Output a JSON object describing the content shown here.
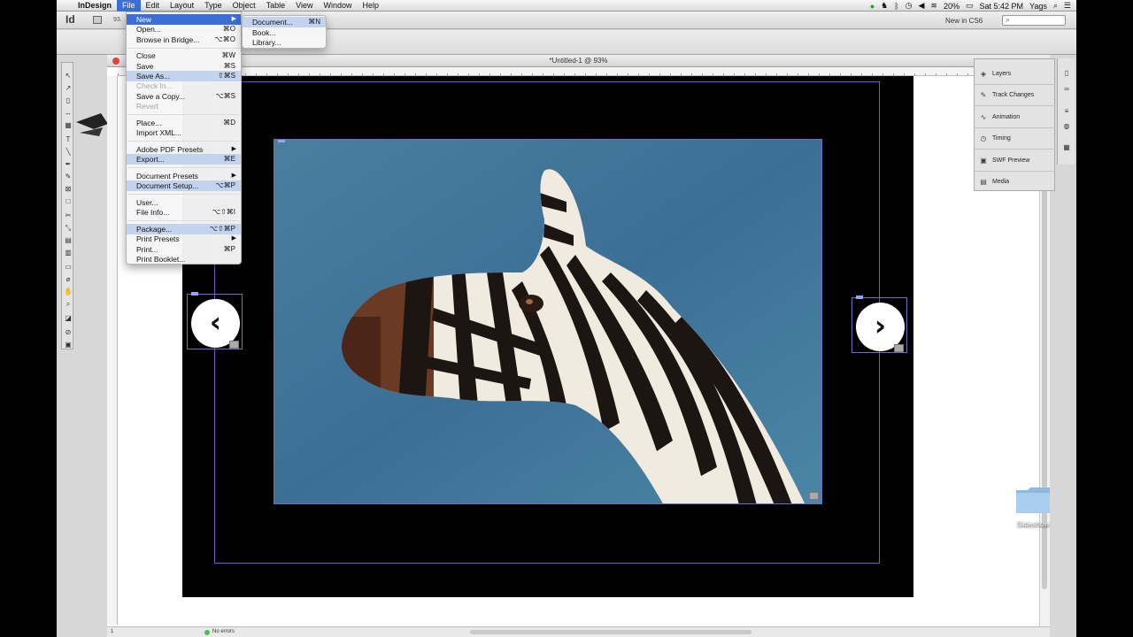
{
  "menubar": {
    "app_name": "InDesign",
    "items": [
      "File",
      "Edit",
      "Layout",
      "Type",
      "Object",
      "Table",
      "View",
      "Window",
      "Help"
    ],
    "battery": "20%",
    "clock": "Sat 5:42 PM",
    "user": "Yags"
  },
  "appbar": {
    "logo": "Id",
    "zoom_text": "93.",
    "workspace": "New in CS6"
  },
  "file_menu": {
    "items": [
      {
        "label": "New",
        "shortcut": "",
        "submenu": true,
        "state": "active"
      },
      {
        "label": "Open...",
        "shortcut": "⌘O"
      },
      {
        "label": "Browse in Bridge...",
        "shortcut": "⌥⌘O"
      },
      {
        "label": "Close",
        "shortcut": "⌘W"
      },
      {
        "label": "Save",
        "shortcut": "⌘S"
      },
      {
        "label": "Save As...",
        "shortcut": "⇧⌘S",
        "state": "highlight"
      },
      {
        "label": "Check In...",
        "shortcut": "",
        "state": "disabled"
      },
      {
        "label": "Save a Copy...",
        "shortcut": "⌥⌘S"
      },
      {
        "label": "Revert",
        "shortcut": "",
        "state": "disabled"
      },
      {
        "label": "Place...",
        "shortcut": "⌘D"
      },
      {
        "label": "Import XML...",
        "shortcut": ""
      },
      {
        "label": "Adobe PDF Presets",
        "shortcut": "",
        "submenu": true
      },
      {
        "label": "Export...",
        "shortcut": "⌘E",
        "state": "highlight"
      },
      {
        "label": "Document Presets",
        "shortcut": "",
        "submenu": true
      },
      {
        "label": "Document Setup...",
        "shortcut": "⌥⌘P",
        "state": "highlight"
      },
      {
        "label": "User...",
        "shortcut": ""
      },
      {
        "label": "File Info...",
        "shortcut": "⌥⇧⌘I"
      },
      {
        "label": "Package...",
        "shortcut": "⌥⇧⌘P",
        "state": "highlight"
      },
      {
        "label": "Print Presets",
        "shortcut": "",
        "submenu": true
      },
      {
        "label": "Print...",
        "shortcut": "⌘P"
      },
      {
        "label": "Print Booklet...",
        "shortcut": ""
      }
    ]
  },
  "new_submenu": {
    "items": [
      {
        "label": "Document...",
        "shortcut": "⌘N",
        "state": "highlight"
      },
      {
        "label": "Book...",
        "shortcut": ""
      },
      {
        "label": "Library...",
        "shortcut": ""
      }
    ]
  },
  "document": {
    "title": "*Untitled-1 @ 93%",
    "page_field": "1",
    "status": "No errors"
  },
  "panels": {
    "items": [
      "Layers",
      "Track Changes",
      "Animation",
      "Timing",
      "SWF Preview",
      "Media"
    ]
  },
  "desktop": {
    "folder_label": "Slideshow"
  },
  "colors": {
    "menu_highlight": "#3b6fd3",
    "menu_soft_highlight": "#c3d3ee",
    "frame_guide": "#6e6eb9",
    "margin_guide": "#7a58c9",
    "page_bg": "#000000"
  }
}
